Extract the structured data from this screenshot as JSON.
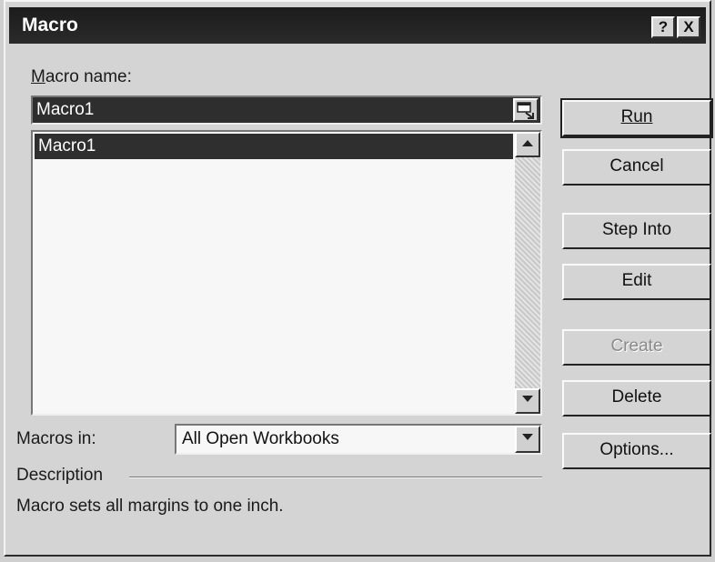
{
  "window": {
    "title": "Macro",
    "help_glyph": "?",
    "close_glyph": "X"
  },
  "macro_name": {
    "label": "Macro name:",
    "value": "Macro1"
  },
  "macro_list": {
    "items": [
      "Macro1"
    ],
    "selected_index": 0
  },
  "buttons": {
    "run": "Run",
    "cancel": "Cancel",
    "step_into": "Step Into",
    "edit": "Edit",
    "create": "Create",
    "delete": "Delete",
    "options": "Options..."
  },
  "macros_in": {
    "label": "Macros in:",
    "value": "All Open Workbooks"
  },
  "description": {
    "label": "Description",
    "text": "Macro sets all margins to one inch."
  },
  "icons": {
    "collapse": "collapse-dialog-icon",
    "scroll_up": "scroll-up-arrow-icon",
    "scroll_down": "scroll-down-arrow-icon",
    "dropdown": "dropdown-arrow-icon"
  }
}
